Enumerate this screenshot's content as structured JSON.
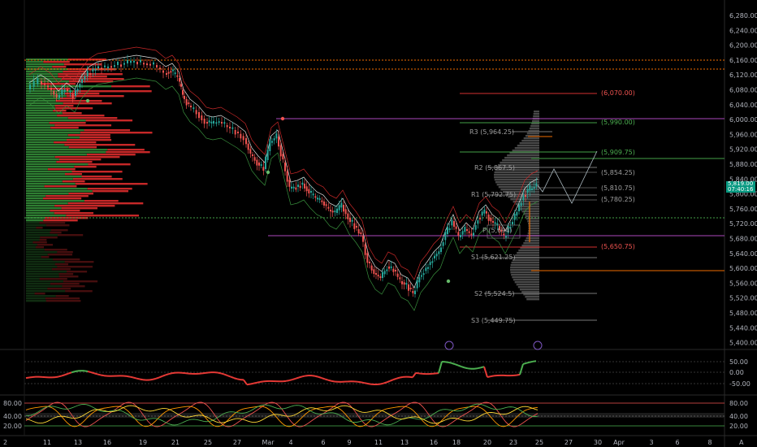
{
  "price_axis": {
    "labels": [
      "6,280.00",
      "6,240.00",
      "6,200.00",
      "6,160.00",
      "6,120.00",
      "6,080.00",
      "6,040.00",
      "6,000.00",
      "5,960.00",
      "5,920.00",
      "5,880.00",
      "5,840.00",
      "5,800.00",
      "5,760.00",
      "5,720.00",
      "5,680.00",
      "5,640.00",
      "5,600.00",
      "5,560.00",
      "5,520.00",
      "5,480.00",
      "5,440.00",
      "5,400.00"
    ],
    "last_price": "5,819.00",
    "countdown": "07:40:16"
  },
  "time_axis": {
    "labels": [
      "11",
      "13",
      "16",
      "19",
      "21",
      "25",
      "27",
      "Mar",
      "4",
      "6",
      "9",
      "11",
      "13",
      "16",
      "18",
      "20",
      "23",
      "25",
      "27",
      "30",
      "Apr",
      "3",
      "6",
      "8"
    ],
    "corner_left": "2",
    "corner_right": "A"
  },
  "levels": {
    "top_red": "(6,070.00)",
    "green_top": "(5,990.00)",
    "r3": "R3 (5,964.25)",
    "green_mid": "(5,909.75)",
    "r2": "R2 (5,867.5)",
    "grey1": "(5,854.25)",
    "grey2": "(5,810.75)",
    "r1": "R1 (5,792.75)",
    "grey3": "(5,780.25)",
    "pivot": "P (5,694)",
    "red_low": "(5,650.75)",
    "s1": "S1 (5,621.25)",
    "s2": "S2 (5,524.5)",
    "s3": "S3 (5,449.75)"
  },
  "oscillator1": {
    "labels": [
      "50.00",
      "0.00",
      "-50.00"
    ]
  },
  "oscillator2": {
    "labels": [
      "80.00",
      "40.00",
      "20.00"
    ]
  },
  "colors": {
    "up": "#26a69a",
    "down": "#ef5350",
    "accent": "#089981"
  }
}
